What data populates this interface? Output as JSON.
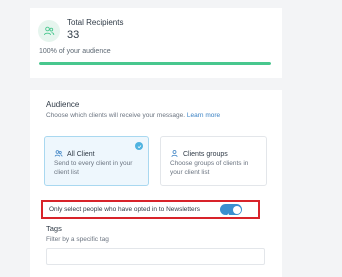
{
  "recipients": {
    "icon": "users-icon",
    "title": "Total Recipients",
    "count": "33",
    "audience_text": "100% of your audience",
    "progress_fraction": 1.0,
    "progress_color": "#48c78e"
  },
  "audience": {
    "title": "Audience",
    "description": "Choose which clients will receive your message.",
    "learn_more": "Learn more",
    "options": [
      {
        "icon": "users-icon",
        "label": "All Client",
        "description": "Send to every client in your client list",
        "selected": true
      },
      {
        "icon": "user-icon",
        "label": "Clients groups",
        "description": "Choose groups of clients in your client list",
        "selected": false
      }
    ],
    "optin_label": "Only select people who have opted in to Newsletters",
    "optin_enabled": true,
    "accent_color": "#3b8fd0",
    "highlight_color": "#d8232a"
  },
  "tags": {
    "title": "Tags",
    "subtitle": "Filter by a specific tag",
    "input_value": "",
    "input_placeholder": ""
  }
}
